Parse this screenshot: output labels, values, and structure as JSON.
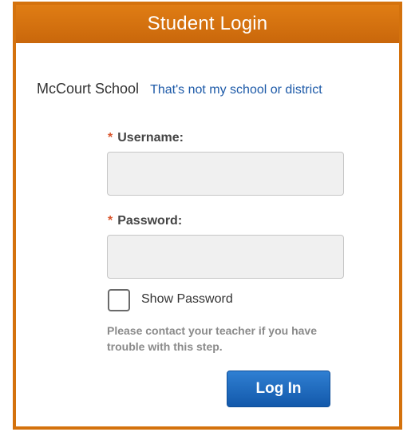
{
  "header": {
    "title": "Student Login"
  },
  "school": {
    "name": "McCourt School",
    "change_link": "That's not my school or district"
  },
  "form": {
    "required_marker": "*",
    "username_label": "Username:",
    "username_value": "",
    "password_label": "Password:",
    "password_value": "",
    "show_password_label": "Show Password",
    "show_password_checked": false,
    "help_text": "Please contact your teacher if you have trouble with this step.",
    "login_button": "Log In"
  },
  "colors": {
    "header_orange": "#d4720d",
    "link_blue": "#1d5aa8",
    "button_blue": "#1a64b8",
    "required_red": "#d9542b"
  }
}
